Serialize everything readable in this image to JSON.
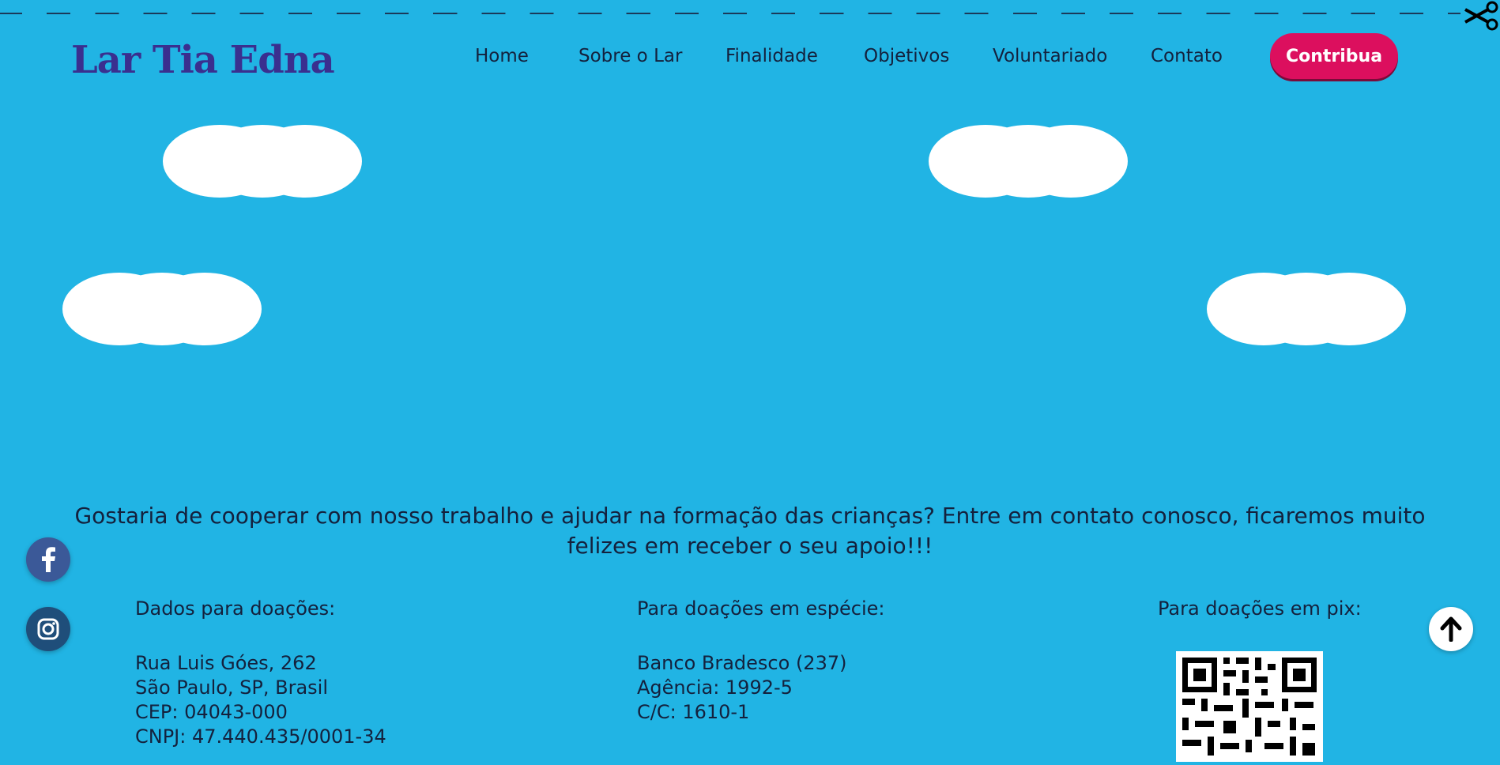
{
  "brand": {
    "logo_text": "Lar Tia Edna"
  },
  "nav": {
    "items": [
      "Home",
      "Sobre o Lar",
      "Finalidade",
      "Objetivos",
      "Voluntariado",
      "Contato"
    ],
    "cta_label": "Contribua"
  },
  "invite_text": "Gostaria de cooperar com nosso trabalho e ajudar na formação das crianças? Entre em contato conosco, ficaremos muito felizes em receber o seu apoio!!!",
  "donations": {
    "address": {
      "title": "Dados para doações:",
      "lines": [
        "Rua Luis Góes, 262",
        "São Paulo, SP, Brasil",
        "CEP: 04043-000",
        "CNPJ: 47.440.435/0001-34"
      ]
    },
    "bank": {
      "title": "Para doações em espécie:",
      "lines": [
        "Banco Bradesco (237)",
        "Agência: 1992-5",
        "C/C: 1610-1"
      ]
    },
    "pix": {
      "title": "Para doações em pix:"
    }
  },
  "icons": {
    "scissors": "scissors-icon",
    "facebook": "facebook-icon",
    "instagram": "instagram-icon",
    "scroll_top": "arrow-up-icon",
    "qr": "pix-qr-code"
  },
  "colors": {
    "background": "#21b4e4",
    "logo": "#3a2f8f",
    "cta": "#dc0f5e",
    "text": "#14213d"
  }
}
